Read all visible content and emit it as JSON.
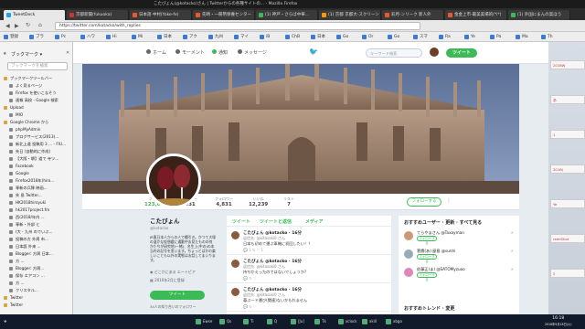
{
  "window": {
    "title": "こたびょん(@kotacko)さん | Twitterからの各種サイトの... - Mozilla Firefox",
    "top_text": "Tweetdeck"
  },
  "tabs": [
    {
      "label": "TweetDeck",
      "color": "#1da1f2"
    },
    {
      "label": "京都新聞(fukuoka)",
      "color": "#c33"
    },
    {
      "label": "日本語 中村(Yoke-fe)",
      "color": "#e53"
    },
    {
      "label": "先晴・一冊幣保養センター",
      "color": "#e53"
    },
    {
      "label": "(1) 神戸・さらば中華...",
      "color": "#3bba56"
    },
    {
      "label": "(1) 京都 京都大-スクリーン",
      "color": "#f90"
    },
    {
      "label": "彩月-ンリーク 新人外",
      "color": "#e53"
    },
    {
      "label": "金金上市-最美美場的(*i*)",
      "color": "#e53"
    },
    {
      "label": "(1) 外国にまんの案ほう",
      "color": "#3bba56"
    }
  ],
  "navbar": {
    "url": "https://twitter.com/kotacko/with_replies"
  },
  "bookmarks": [
    "登録",
    "ブラ",
    "Pc",
    "ハワ",
    "Hi",
    "Mi",
    "日本",
    "アク",
    "九州",
    "マイ",
    "iB",
    "ChB",
    "日本",
    "Go",
    "Or",
    "Go",
    "スマ",
    "Ra",
    "Ye",
    "Pa",
    "Ma",
    "Th"
  ],
  "sidebar": {
    "title": "ブックマーク ▾",
    "search_placeholder": "ブックマークを検索",
    "items": [
      "ブックマークツールバー",
      "よく見るページ",
      "Firefox を使いこなそう",
      "速報 高校 - Google 検索",
      "Upload",
      "MIO",
      "Google Chrome から",
      "phpMyAdmin",
      "ブログサービス(2013)...",
      "新北上道 投稿用 3 … - FIU...",
      "先日 (自動的に作成)",
      "【大阪・堺】道で 寺ツ...",
      "Facebook",
      "Google",
      "Firefox2018年(hiro...",
      "専新の兵隊 映画...",
      "先 島 Twitter...",
      "HK2018hiroyuki",
      "hk2017project.fm",
      "西(2018/年内 ...",
      "専新・外部 と",
      "(大 - 九州 のでいぶ...",
      "投稿の方 外周 市...",
      "日本語 外来 ...",
      "Blogger: 方周 日本...",
      "方 ...",
      "Blogger: 方周...",
      "保存 エアコン ...",
      "方 ...",
      "クリスタル...",
      "Twitter",
      "Twitter"
    ]
  },
  "twitter": {
    "nav": [
      "ホーム",
      "モーメント",
      "通知",
      "メッセージ"
    ],
    "search_placeholder": "キーワード検索",
    "tweet_button": "ツイート",
    "stats": [
      {
        "label": "ツイート",
        "value": "123,046"
      },
      {
        "label": "フォロー",
        "value": "431"
      },
      {
        "label": "フォロワー",
        "value": "4,831"
      },
      {
        "label": "いいね",
        "value": "12,239"
      },
      {
        "label": "リスト",
        "value": "7"
      }
    ],
    "follow_button": "フォローする",
    "profile": {
      "name": "こたびょん",
      "handle": "@kotacko",
      "bio": "JR東日本人からの人で種引き。かつて大塚の温かな仮想戯に通勤中お見たものの何かたちが研究地(一緒)、名生上(中の)の本当内の記号を思います。ちょっとはかの楽しいことも以外の実態はお話してまいります。",
      "location": "どこかにある エートピア",
      "joined": "2010年2月に登録",
      "tweet_button": "ツイート",
      "followers_note": "34人の知り合いのフォロワー"
    },
    "timeline_tabs": [
      "ツイート",
      "ツイートと返信",
      "メディア"
    ],
    "tweets": [
      {
        "name": "こたびょん @kotacko · 16分",
        "reply": "返信先: @kitasaki0 さん",
        "text": "日本も初めて運ぶ車機に初回したい！？",
        "actions": "💬 1   ↻   ♡ 1"
      },
      {
        "name": "こたびょん @kotacko · 16分",
        "reply": "返信先: @kitasaki0 さん",
        "text": "持ちかえったのではないでしょうか?",
        "actions": "💬   ↻   ♡"
      },
      {
        "name": "こたびょん @kotacko · 16分",
        "reply": "返信先: @kitasaki0 さん",
        "text": "尊ぶ一ド運び(関連)ないかもれません",
        "actions": "💬   ↻   ♡"
      }
    ],
    "suggest_title": "おすすめユーザー · 更新 · すべて見る",
    "suggest": [
      {
        "name": "てらやまさん @Taxayman",
        "follow": "フォローする",
        "color": "#c97"
      },
      {
        "name": "菅鷹(あ) 屋島 @sunhi",
        "follow": "フォローする",
        "color": "#9ab"
      },
      {
        "name": "佐藤正(ま) @SATOMyzuoo",
        "follow": "フォローする",
        "color": "#d8b"
      }
    ],
    "trend_title": "おすすめトレンド · 変更"
  },
  "right_panels": [
    "2016W",
    "あ",
    "1",
    "2018(",
    "Ye",
    "reenShot",
    "2"
  ],
  "taskbar": {
    "items": [
      "Ewse",
      "Qs",
      "Ti",
      "Q",
      "[Ju]",
      "Tk",
      "xclock",
      "xkill",
      "xbgo"
    ],
    "time": "16:18",
    "date": "2018年9月18日(火)"
  }
}
